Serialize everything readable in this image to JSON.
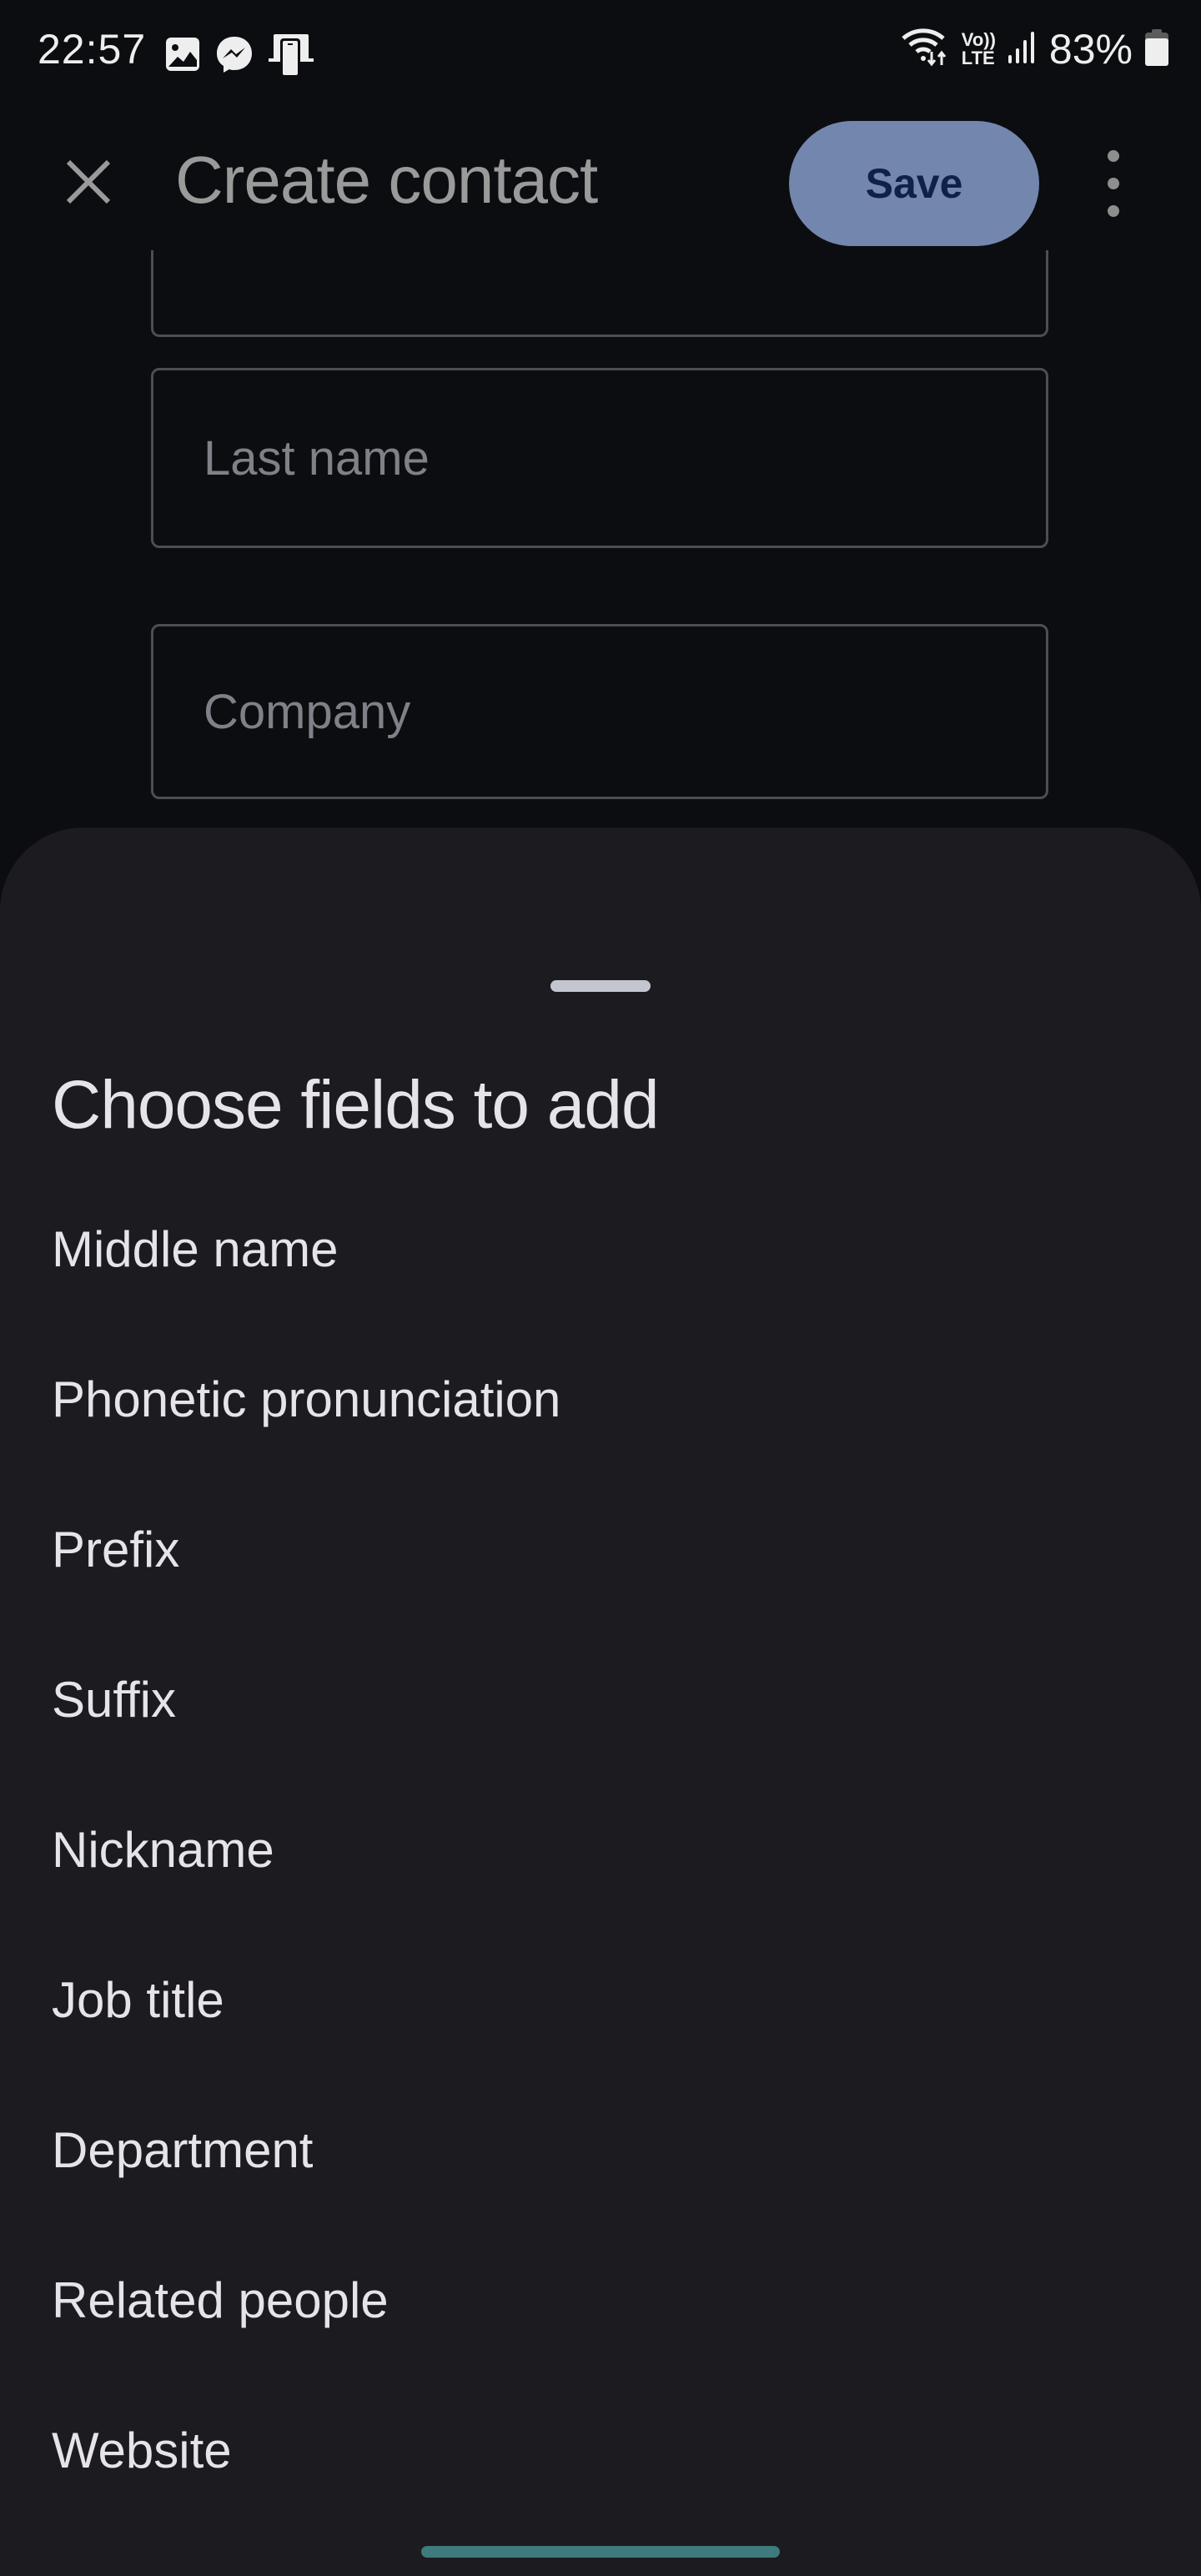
{
  "status_bar": {
    "time": "22:57",
    "notification_icons": [
      "gallery-icon",
      "messenger-icon",
      "device-cast-icon"
    ],
    "system_icons": [
      "wifi-data-icon",
      "volte-lte-icon",
      "signal-icon"
    ],
    "volte_top": "Vo))",
    "volte_bottom": "LTE",
    "battery_percent": "83%",
    "battery_level": 0.83
  },
  "header": {
    "close_icon": "close-icon",
    "title": "Create contact",
    "save_label": "Save",
    "more_icon": "more-vert-icon"
  },
  "form": {
    "fields": [
      {
        "name": "first-name",
        "placeholder": "",
        "value": ""
      },
      {
        "name": "last-name",
        "placeholder": "Last name",
        "value": ""
      },
      {
        "name": "company",
        "placeholder": "Company",
        "value": ""
      }
    ]
  },
  "sheet": {
    "title": "Choose fields to add",
    "items": [
      "Middle name",
      "Phonetic pronunciation",
      "Prefix",
      "Suffix",
      "Nickname",
      "Job title",
      "Department",
      "Related people",
      "Website"
    ]
  },
  "colors": {
    "background": "#0c0d10",
    "sheet": "#1c1b20",
    "save_button": "#7386ad",
    "save_text": "#0f2148",
    "nav_pill": "#3f7a7c"
  }
}
